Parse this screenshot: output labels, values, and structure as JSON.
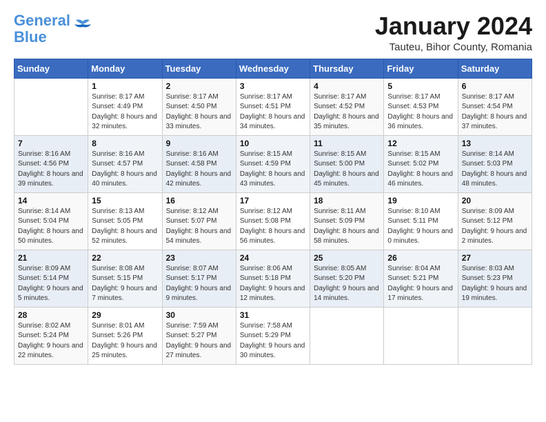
{
  "logo": {
    "general": "General",
    "blue": "Blue"
  },
  "header": {
    "month": "January 2024",
    "location": "Tauteu, Bihor County, Romania"
  },
  "weekdays": [
    "Sunday",
    "Monday",
    "Tuesday",
    "Wednesday",
    "Thursday",
    "Friday",
    "Saturday"
  ],
  "weeks": [
    [
      {
        "day": "",
        "sunrise": "",
        "sunset": "",
        "daylight": ""
      },
      {
        "day": "1",
        "sunrise": "Sunrise: 8:17 AM",
        "sunset": "Sunset: 4:49 PM",
        "daylight": "Daylight: 8 hours and 32 minutes."
      },
      {
        "day": "2",
        "sunrise": "Sunrise: 8:17 AM",
        "sunset": "Sunset: 4:50 PM",
        "daylight": "Daylight: 8 hours and 33 minutes."
      },
      {
        "day": "3",
        "sunrise": "Sunrise: 8:17 AM",
        "sunset": "Sunset: 4:51 PM",
        "daylight": "Daylight: 8 hours and 34 minutes."
      },
      {
        "day": "4",
        "sunrise": "Sunrise: 8:17 AM",
        "sunset": "Sunset: 4:52 PM",
        "daylight": "Daylight: 8 hours and 35 minutes."
      },
      {
        "day": "5",
        "sunrise": "Sunrise: 8:17 AM",
        "sunset": "Sunset: 4:53 PM",
        "daylight": "Daylight: 8 hours and 36 minutes."
      },
      {
        "day": "6",
        "sunrise": "Sunrise: 8:17 AM",
        "sunset": "Sunset: 4:54 PM",
        "daylight": "Daylight: 8 hours and 37 minutes."
      }
    ],
    [
      {
        "day": "7",
        "sunrise": "Sunrise: 8:16 AM",
        "sunset": "Sunset: 4:56 PM",
        "daylight": "Daylight: 8 hours and 39 minutes."
      },
      {
        "day": "8",
        "sunrise": "Sunrise: 8:16 AM",
        "sunset": "Sunset: 4:57 PM",
        "daylight": "Daylight: 8 hours and 40 minutes."
      },
      {
        "day": "9",
        "sunrise": "Sunrise: 8:16 AM",
        "sunset": "Sunset: 4:58 PM",
        "daylight": "Daylight: 8 hours and 42 minutes."
      },
      {
        "day": "10",
        "sunrise": "Sunrise: 8:15 AM",
        "sunset": "Sunset: 4:59 PM",
        "daylight": "Daylight: 8 hours and 43 minutes."
      },
      {
        "day": "11",
        "sunrise": "Sunrise: 8:15 AM",
        "sunset": "Sunset: 5:00 PM",
        "daylight": "Daylight: 8 hours and 45 minutes."
      },
      {
        "day": "12",
        "sunrise": "Sunrise: 8:15 AM",
        "sunset": "Sunset: 5:02 PM",
        "daylight": "Daylight: 8 hours and 46 minutes."
      },
      {
        "day": "13",
        "sunrise": "Sunrise: 8:14 AM",
        "sunset": "Sunset: 5:03 PM",
        "daylight": "Daylight: 8 hours and 48 minutes."
      }
    ],
    [
      {
        "day": "14",
        "sunrise": "Sunrise: 8:14 AM",
        "sunset": "Sunset: 5:04 PM",
        "daylight": "Daylight: 8 hours and 50 minutes."
      },
      {
        "day": "15",
        "sunrise": "Sunrise: 8:13 AM",
        "sunset": "Sunset: 5:05 PM",
        "daylight": "Daylight: 8 hours and 52 minutes."
      },
      {
        "day": "16",
        "sunrise": "Sunrise: 8:12 AM",
        "sunset": "Sunset: 5:07 PM",
        "daylight": "Daylight: 8 hours and 54 minutes."
      },
      {
        "day": "17",
        "sunrise": "Sunrise: 8:12 AM",
        "sunset": "Sunset: 5:08 PM",
        "daylight": "Daylight: 8 hours and 56 minutes."
      },
      {
        "day": "18",
        "sunrise": "Sunrise: 8:11 AM",
        "sunset": "Sunset: 5:09 PM",
        "daylight": "Daylight: 8 hours and 58 minutes."
      },
      {
        "day": "19",
        "sunrise": "Sunrise: 8:10 AM",
        "sunset": "Sunset: 5:11 PM",
        "daylight": "Daylight: 9 hours and 0 minutes."
      },
      {
        "day": "20",
        "sunrise": "Sunrise: 8:09 AM",
        "sunset": "Sunset: 5:12 PM",
        "daylight": "Daylight: 9 hours and 2 minutes."
      }
    ],
    [
      {
        "day": "21",
        "sunrise": "Sunrise: 8:09 AM",
        "sunset": "Sunset: 5:14 PM",
        "daylight": "Daylight: 9 hours and 5 minutes."
      },
      {
        "day": "22",
        "sunrise": "Sunrise: 8:08 AM",
        "sunset": "Sunset: 5:15 PM",
        "daylight": "Daylight: 9 hours and 7 minutes."
      },
      {
        "day": "23",
        "sunrise": "Sunrise: 8:07 AM",
        "sunset": "Sunset: 5:17 PM",
        "daylight": "Daylight: 9 hours and 9 minutes."
      },
      {
        "day": "24",
        "sunrise": "Sunrise: 8:06 AM",
        "sunset": "Sunset: 5:18 PM",
        "daylight": "Daylight: 9 hours and 12 minutes."
      },
      {
        "day": "25",
        "sunrise": "Sunrise: 8:05 AM",
        "sunset": "Sunset: 5:20 PM",
        "daylight": "Daylight: 9 hours and 14 minutes."
      },
      {
        "day": "26",
        "sunrise": "Sunrise: 8:04 AM",
        "sunset": "Sunset: 5:21 PM",
        "daylight": "Daylight: 9 hours and 17 minutes."
      },
      {
        "day": "27",
        "sunrise": "Sunrise: 8:03 AM",
        "sunset": "Sunset: 5:23 PM",
        "daylight": "Daylight: 9 hours and 19 minutes."
      }
    ],
    [
      {
        "day": "28",
        "sunrise": "Sunrise: 8:02 AM",
        "sunset": "Sunset: 5:24 PM",
        "daylight": "Daylight: 9 hours and 22 minutes."
      },
      {
        "day": "29",
        "sunrise": "Sunrise: 8:01 AM",
        "sunset": "Sunset: 5:26 PM",
        "daylight": "Daylight: 9 hours and 25 minutes."
      },
      {
        "day": "30",
        "sunrise": "Sunrise: 7:59 AM",
        "sunset": "Sunset: 5:27 PM",
        "daylight": "Daylight: 9 hours and 27 minutes."
      },
      {
        "day": "31",
        "sunrise": "Sunrise: 7:58 AM",
        "sunset": "Sunset: 5:29 PM",
        "daylight": "Daylight: 9 hours and 30 minutes."
      },
      {
        "day": "",
        "sunrise": "",
        "sunset": "",
        "daylight": ""
      },
      {
        "day": "",
        "sunrise": "",
        "sunset": "",
        "daylight": ""
      },
      {
        "day": "",
        "sunrise": "",
        "sunset": "",
        "daylight": ""
      }
    ]
  ]
}
